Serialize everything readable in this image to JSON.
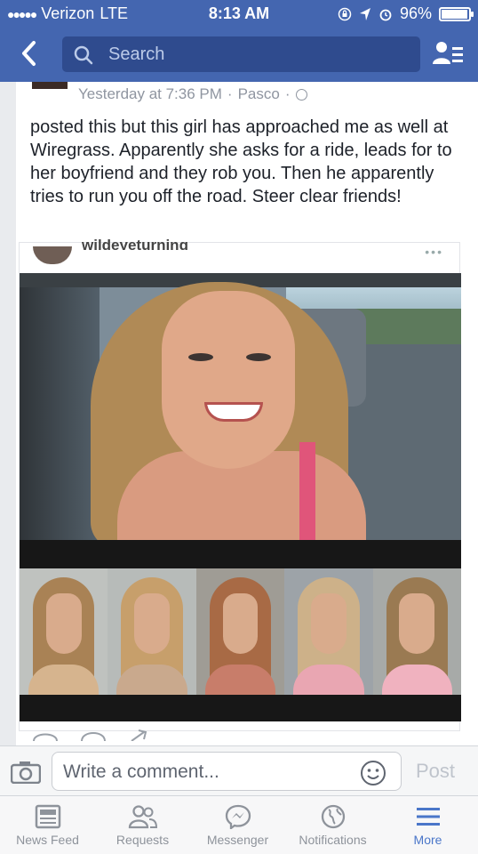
{
  "status_bar": {
    "carrier": "Verizon",
    "network": "LTE",
    "time": "8:13 AM",
    "battery": "96%",
    "battery_level": 0.96
  },
  "nav": {
    "search_placeholder": "Search"
  },
  "post": {
    "meta_time": "Yesterday at 7:36 PM",
    "meta_sep1": "·",
    "meta_location": "Pasco",
    "meta_sep2": "·",
    "body": "posted this but this girl has approached me as well at Wiregrass. Apparently she asks for a ride, leads for to her boyfriend and they rob you. Then he apparently tries to run you off the road. Steer clear friends!",
    "shared_author": "wildeyeturning"
  },
  "mugshots": [
    {
      "hair": "#a98255",
      "shirt": "#d6b48e",
      "bg": "#bfc2bf"
    },
    {
      "hair": "#c79f6b",
      "shirt": "#c9a98d",
      "bg": "#b7bbb9"
    },
    {
      "hair": "#a86a45",
      "shirt": "#c87d6a",
      "bg": "#9f9c95"
    },
    {
      "hair": "#cdb189",
      "shirt": "#e9a6b2",
      "bg": "#9da3a8"
    },
    {
      "hair": "#9a7a52",
      "shirt": "#f0b2bf",
      "bg": "#a7aaa8"
    }
  ],
  "comment": {
    "placeholder": "Write a comment...",
    "post_label": "Post"
  },
  "tabs": [
    {
      "label": "News Feed",
      "icon": "news-feed-icon"
    },
    {
      "label": "Requests",
      "icon": "requests-icon"
    },
    {
      "label": "Messenger",
      "icon": "messenger-icon"
    },
    {
      "label": "Notifications",
      "icon": "notifications-globe-icon"
    },
    {
      "label": "More",
      "icon": "menu-icon",
      "active": true
    }
  ],
  "colors": {
    "brand": "#4466b0",
    "active_tab": "#4a76c9"
  }
}
